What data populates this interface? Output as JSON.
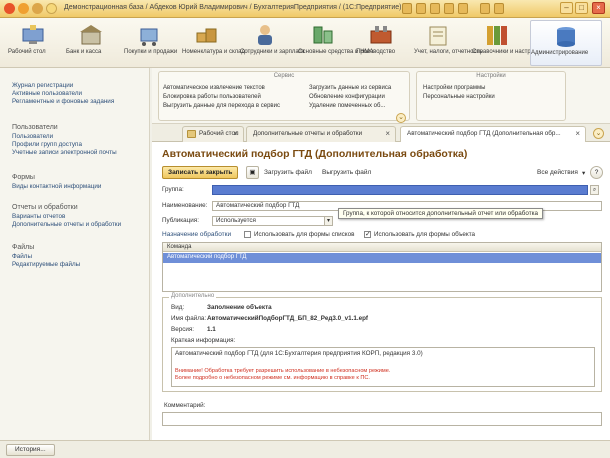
{
  "window": {
    "title": "Демонстрационная база / Абдеков Юрий Владимирович / БухгалтерияПредприятия / (1С:Предприятие)"
  },
  "sections": [
    {
      "label": "Рабочий стол",
      "icon": "desktop-icon"
    },
    {
      "label": "Банк и касса",
      "icon": "bank-icon"
    },
    {
      "label": "Покупки и продажи",
      "icon": "cart-icon"
    },
    {
      "label": "Номенклатура и склад",
      "icon": "warehouse-icon"
    },
    {
      "label": "Сотрудники и зарплата",
      "icon": "employee-icon"
    },
    {
      "label": "Основные средства и НМА",
      "icon": "assets-icon"
    },
    {
      "label": "Производство",
      "icon": "production-icon"
    },
    {
      "label": "Учет, налоги, отчетность",
      "icon": "accounting-icon"
    },
    {
      "label": "Справочники и настройки учета",
      "icon": "books-icon"
    },
    {
      "label": "Администрирование",
      "icon": "admin-icon"
    }
  ],
  "sidebar": {
    "top_links": [
      "Журнал регистрации",
      "Активные пользователи",
      "Регламентные и фоновые задания"
    ],
    "groups": [
      {
        "header": "Пользователи",
        "items": [
          "Пользователи",
          "Профили групп доступа",
          "Учетные записи электронной почты"
        ]
      },
      {
        "header": "Формы",
        "items": [
          "Виды контактной информации"
        ]
      },
      {
        "header": "Отчеты и обработки",
        "items": [
          "Варианты отчетов",
          "Дополнительные отчеты и обработки"
        ]
      },
      {
        "header": "Файлы",
        "items": [
          "Файлы",
          "Редактируемые файлы"
        ]
      }
    ]
  },
  "func_panel": {
    "service_title": "Сервис",
    "service_col1": [
      "Автоматическое извлечение текстов",
      "Блокировка работы пользователей",
      "Выгрузить данные для перехода в сервис"
    ],
    "service_col2": [
      "Загрузить данные из сервиса",
      "Обновление конфигурации",
      "Удаление помеченных об..."
    ],
    "settings_title": "Настройки",
    "settings_items": [
      "Настройки программы",
      "Персональные настройки"
    ]
  },
  "tabs": [
    {
      "label": "Рабочий стол"
    },
    {
      "label": "Дополнительные отчеты и обработки"
    },
    {
      "label": "Автоматический подбор ГТД (Дополнительная обр..."
    }
  ],
  "form": {
    "title": "Автоматический подбор ГТД (Дополнительная обработка)",
    "btn_save_close": "Записать и закрыть",
    "btn_load": "Загрузить файл",
    "btn_unload": "Выгрузить файл",
    "all_actions": "Все действия",
    "group_label": "Группа:",
    "name_label": "Наименование:",
    "name_value": "Автоматический подбор ГТД",
    "publication_label": "Публикация:",
    "publication_value": "Используется",
    "tooltip": "Группа, к которой относится дополнительный отчет или обработка",
    "purpose_link": "Назначение обработки",
    "cb_list_label": "Использовать для формы списков",
    "cb_list_checked": false,
    "cb_obj_label": "Использовать для формы объекта",
    "cb_obj_checked": true,
    "table_header": "Команда",
    "table_rows": [
      "Автоматический подбор ГТД"
    ],
    "extra_title": "Дополнительно",
    "kind_label": "Вид:",
    "kind_value": "Заполнение объекта",
    "file_label": "Имя файла:",
    "file_value": "АвтоматическийПодборГТД_БП_82_Ред3.0_v1.1.epf",
    "version_label": "Версия:",
    "version_value": "1.1",
    "info_label": "Краткая информация:",
    "info_value": "Автоматический подбор ГТД (для 1С:Бухгалтерия предприятия КОРП, редакция 3.0)",
    "warn1": "Внимание! Обработка требует разрешить использование в небезопасном режиме.",
    "warn2": "Более подробно о небезопасном режиме см. информацию в справке к ПС.",
    "comment_label": "Комментарий:"
  },
  "statusbar": {
    "history": "История..."
  }
}
